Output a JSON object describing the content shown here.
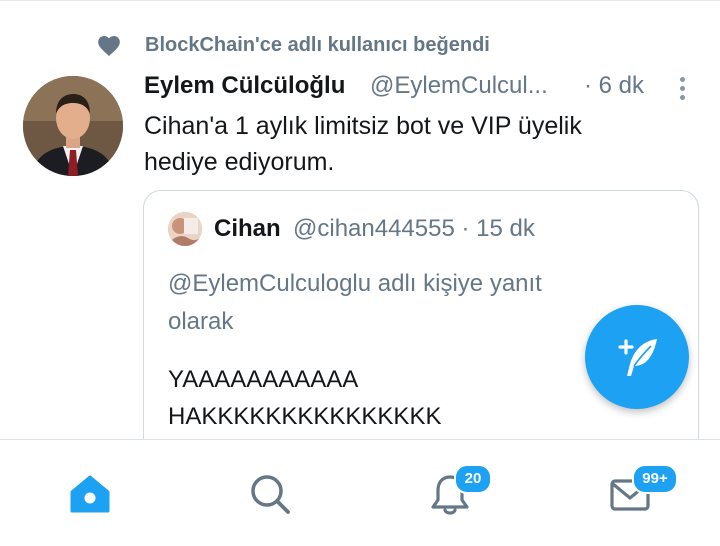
{
  "social_context": {
    "text": "BlockChain'ce adlı kullanıcı beğendi",
    "icon": "heart-icon"
  },
  "tweet": {
    "display_name": "Eylem Cülcüloğlu",
    "handle": "@EylemCulcul...",
    "time": "· 6 dk",
    "text_lines": [
      "Cihan'a 1 aylık limitsiz bot ve VIP üyelik",
      "hediye ediyorum."
    ]
  },
  "quoted_tweet": {
    "display_name": "Cihan",
    "handle_time": "@cihan444555 · 15 dk",
    "reply_lines": [
      "@EylemCulculoglu adlı kişiye yanıt",
      "olarak"
    ],
    "body_lines": [
      "YAAAAAAAAAAA",
      "HAKKKKKKKKKKKKKKK"
    ]
  },
  "compose_button": {
    "icon": "compose-feather-icon"
  },
  "bottom_nav": {
    "items": [
      {
        "name": "home",
        "icon": "home-icon",
        "active": true
      },
      {
        "name": "search",
        "icon": "search-icon"
      },
      {
        "name": "notifications",
        "icon": "bell-icon",
        "badge": "20"
      },
      {
        "name": "messages",
        "icon": "envelope-icon",
        "badge": "99+"
      }
    ]
  },
  "colors": {
    "accent": "#1da1f2",
    "text_primary": "#14171a",
    "text_secondary": "#657786",
    "icon_gray": "#657786"
  }
}
